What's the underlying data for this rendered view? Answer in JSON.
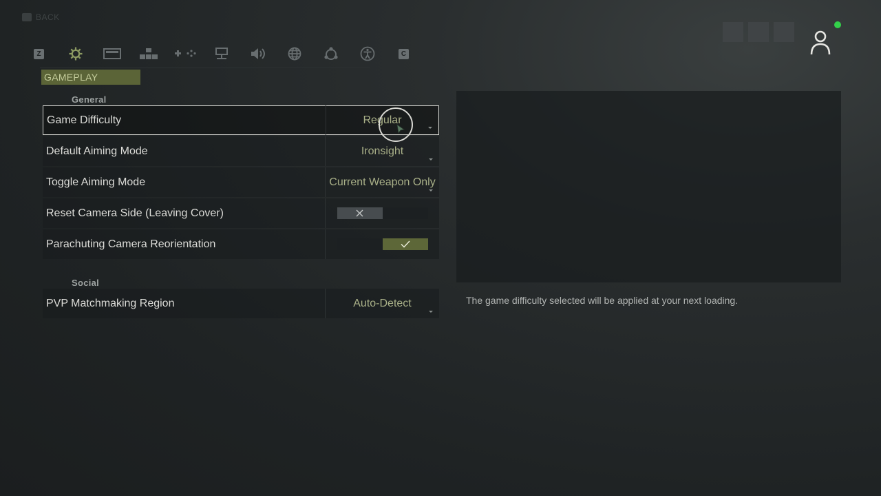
{
  "back_label": "BACK",
  "tabs": [
    {
      "icon": "z-key-icon",
      "key": "Z",
      "active": false
    },
    {
      "icon": "gear-icon",
      "active": true
    },
    {
      "icon": "display-icon",
      "active": false
    },
    {
      "icon": "keyboard-icon",
      "active": false
    },
    {
      "icon": "gamepad-icon",
      "active": false
    },
    {
      "icon": "network-icon",
      "active": false
    },
    {
      "icon": "speaker-icon",
      "active": false
    },
    {
      "icon": "globe-icon",
      "active": false
    },
    {
      "icon": "share-icon",
      "active": false
    },
    {
      "icon": "accessibility-icon",
      "active": false
    },
    {
      "icon": "c-key-icon",
      "key": "C",
      "active": false
    }
  ],
  "section_tag": "GAMEPLAY",
  "groups": {
    "general": "General",
    "social": "Social"
  },
  "rows": [
    {
      "label": "Game Difficulty",
      "value": "Regular",
      "type": "dropdown",
      "selected": true
    },
    {
      "label": "Default Aiming Mode",
      "value": "Ironsight",
      "type": "dropdown"
    },
    {
      "label": "Toggle Aiming Mode",
      "value": "Current Weapon Only",
      "type": "dropdown"
    },
    {
      "label": "Reset Camera Side (Leaving Cover)",
      "type": "toggle",
      "state": "off"
    },
    {
      "label": "Parachuting Camera Reorientation",
      "type": "toggle",
      "state": "on"
    },
    {
      "label": "PVP Matchmaking Region",
      "value": "Auto-Detect",
      "type": "dropdown"
    }
  ],
  "description": "The game difficulty selected will be applied at your next loading.",
  "colors": {
    "accent": "#5b6437",
    "value_text": "#a9b088",
    "online_status": "#33d14a"
  }
}
